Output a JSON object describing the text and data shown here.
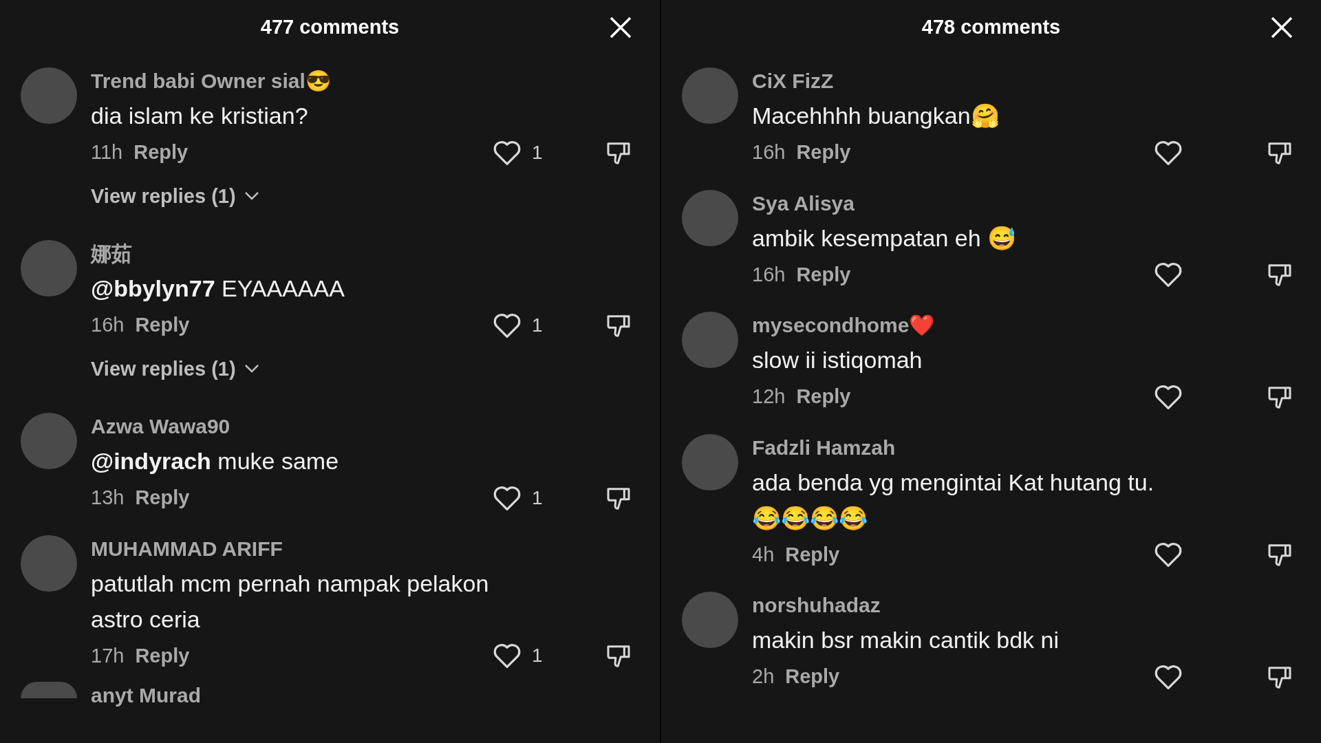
{
  "panels": [
    {
      "title": "477 comments",
      "comments": [
        {
          "name": "Trend babi Owner sial😎",
          "text": "dia islam ke kristian?",
          "time": "11h",
          "reply": "Reply",
          "likes": "1",
          "view_replies": "View replies (1)"
        },
        {
          "name": "娜茹",
          "text": "**@bbylyn77** EYAAAAAA",
          "time": "16h",
          "reply": "Reply",
          "likes": "1",
          "view_replies": "View replies (1)"
        },
        {
          "name": "Azwa Wawa90",
          "text": "**@indyrach** muke same",
          "time": "13h",
          "reply": "Reply",
          "likes": "1"
        },
        {
          "name": "MUHAMMAD ARIFF",
          "text": "patutlah mcm pernah nampak pelakon astro ceria",
          "time": "17h",
          "reply": "Reply",
          "likes": "1"
        },
        {
          "name": "anyt Murad"
        }
      ]
    },
    {
      "title": "478 comments",
      "comments": [
        {
          "name": "CiX FizZ",
          "text": "Macehhhh buangkan🤗",
          "time": "16h",
          "reply": "Reply"
        },
        {
          "name": "Sya Alisya",
          "text": "ambik kesempatan eh 😅",
          "time": "16h",
          "reply": "Reply"
        },
        {
          "name": "mysecondhome❤️",
          "text": "slow ii istiqomah",
          "time": "12h",
          "reply": "Reply"
        },
        {
          "name": "Fadzli Hamzah",
          "text": "ada benda yg mengintai Kat hutang tu. 😂😂😂😂",
          "time": "4h",
          "reply": "Reply"
        },
        {
          "name": "norshuhadaz",
          "text": "makin bsr makin cantik bdk ni",
          "time": "2h",
          "reply": "Reply"
        }
      ]
    }
  ]
}
